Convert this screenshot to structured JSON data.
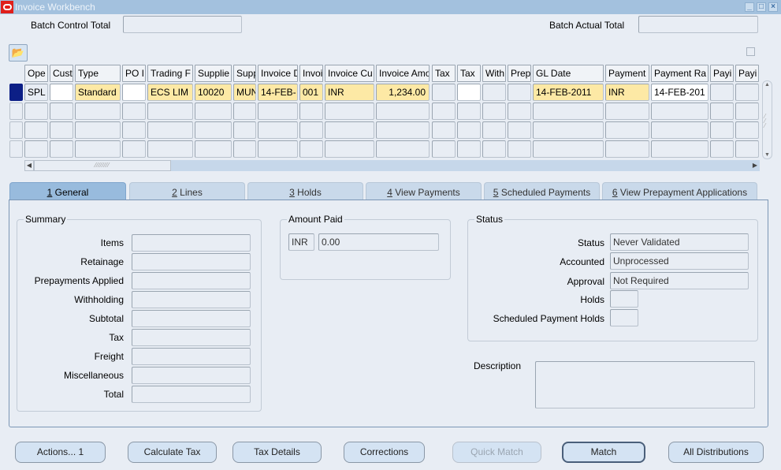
{
  "window": {
    "title": "Invoice Workbench",
    "controls": [
      "minimize",
      "maximize",
      "close"
    ]
  },
  "header": {
    "batch_control_total_label": "Batch Control Total",
    "batch_control_total_value": "",
    "batch_actual_total_label": "Batch Actual Total",
    "batch_actual_total_value": ""
  },
  "toolbar": {
    "open_folder_icon": "folder-open-icon"
  },
  "grid": {
    "columns": [
      "Ope",
      "Cust",
      "Type",
      "PO I",
      "Trading F",
      "Supplie",
      "Supp",
      "Invoice D",
      "Invoi",
      "Invoice Cu",
      "Invoice Amo",
      "Tax",
      "Tax",
      "With",
      "Prep",
      "GL Date",
      "Payment",
      "Payment Ra",
      "Payi",
      "Payi"
    ],
    "rows": [
      [
        "SPL",
        "",
        "Standard",
        "",
        "ECS LIM",
        "10020",
        "MUN",
        "14-FEB-",
        "001",
        "INR",
        "1,234.00",
        "",
        "",
        "",
        "",
        "14-FEB-2011",
        "INR",
        "14-FEB-201",
        "",
        ""
      ],
      [
        "",
        "",
        "",
        "",
        "",
        "",
        "",
        "",
        "",
        "",
        "",
        "",
        "",
        "",
        "",
        "",
        "",
        "",
        "",
        ""
      ],
      [
        "",
        "",
        "",
        "",
        "",
        "",
        "",
        "",
        "",
        "",
        "",
        "",
        "",
        "",
        "",
        "",
        "",
        "",
        "",
        ""
      ],
      [
        "",
        "",
        "",
        "",
        "",
        "",
        "",
        "",
        "",
        "",
        "",
        "",
        "",
        "",
        "",
        "",
        "",
        "",
        "",
        ""
      ]
    ],
    "current_row": 0
  },
  "tabs": [
    {
      "key": "1",
      "label": "General",
      "active": true
    },
    {
      "key": "2",
      "label": "Lines",
      "active": false
    },
    {
      "key": "3",
      "label": "Holds",
      "active": false
    },
    {
      "key": "4",
      "label": "View Payments",
      "active": false
    },
    {
      "key": "5",
      "label": "Scheduled Payments",
      "active": false
    },
    {
      "key": "6",
      "label": "View Prepayment Applications",
      "active": false
    }
  ],
  "summary": {
    "title": "Summary",
    "fields": [
      {
        "label": "Items",
        "value": ""
      },
      {
        "label": "Retainage",
        "value": ""
      },
      {
        "label": "Prepayments Applied",
        "value": ""
      },
      {
        "label": "Withholding",
        "value": ""
      },
      {
        "label": "Subtotal",
        "value": ""
      },
      {
        "label": "Tax",
        "value": ""
      },
      {
        "label": "Freight",
        "value": ""
      },
      {
        "label": "Miscellaneous",
        "value": ""
      },
      {
        "label": "Total",
        "value": ""
      }
    ]
  },
  "amount_paid": {
    "title": "Amount Paid",
    "currency": "INR",
    "amount": "0.00"
  },
  "status": {
    "title": "Status",
    "fields": [
      {
        "label": "Status",
        "value": "Never Validated"
      },
      {
        "label": "Accounted",
        "value": "Unprocessed"
      },
      {
        "label": "Approval",
        "value": "Not Required"
      },
      {
        "label": "Holds",
        "value": ""
      },
      {
        "label": "Scheduled Payment Holds",
        "value": ""
      }
    ]
  },
  "description": {
    "label": "Description",
    "value": ""
  },
  "buttons": [
    {
      "label": "Actions... 1",
      "enabled": true
    },
    {
      "label": "Calculate Tax",
      "enabled": true
    },
    {
      "label": "Tax Details",
      "enabled": true
    },
    {
      "label": "Corrections",
      "enabled": true
    },
    {
      "label": "Quick Match",
      "enabled": false
    },
    {
      "label": "Match",
      "enabled": true,
      "default": true
    },
    {
      "label": "All Distributions",
      "enabled": true
    }
  ]
}
